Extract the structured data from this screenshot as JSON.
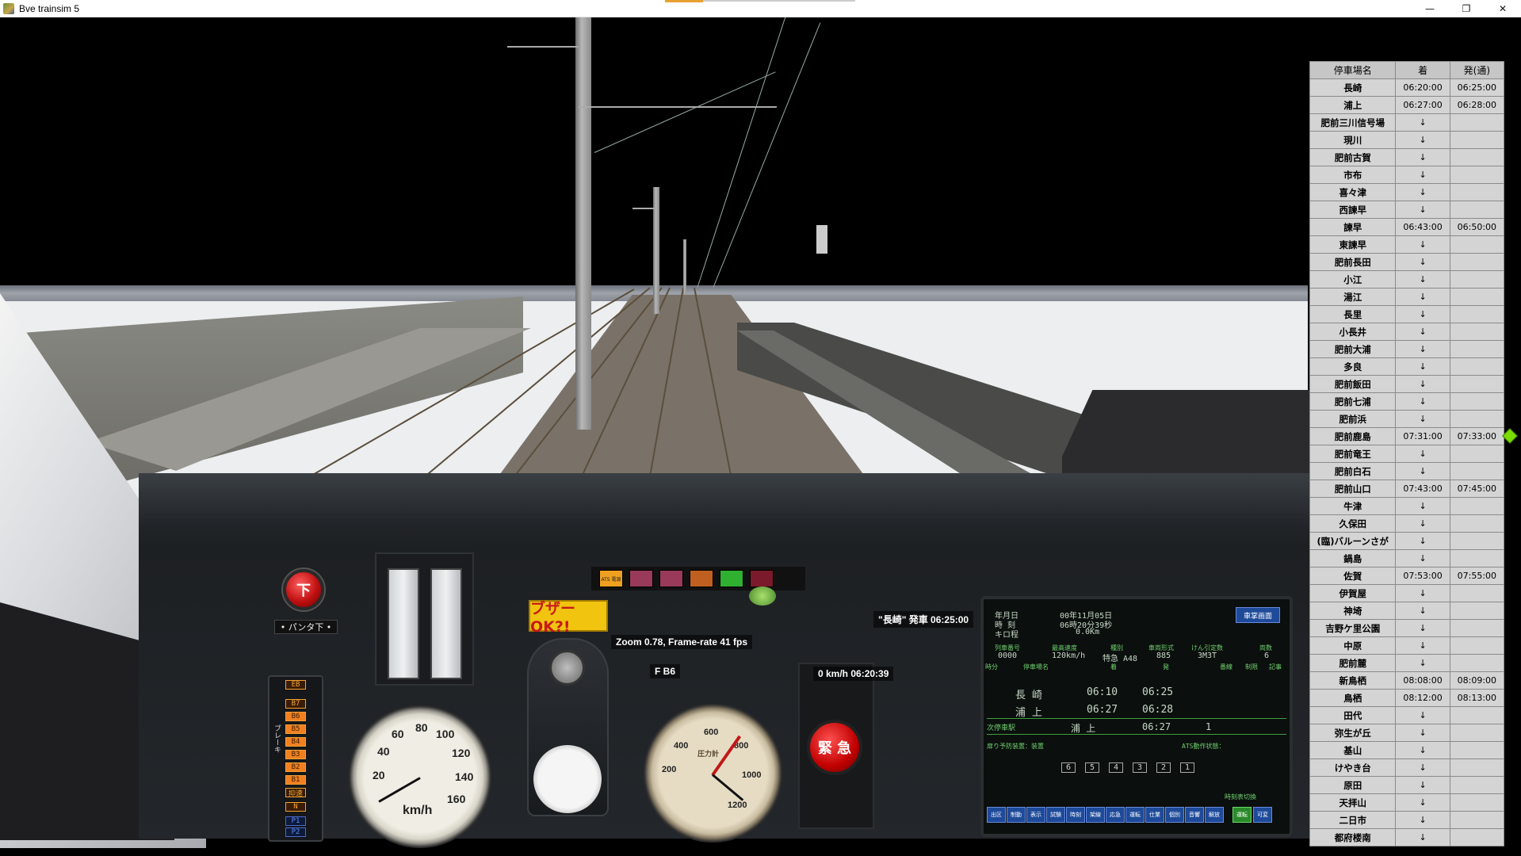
{
  "window": {
    "title": "Bve trainsim 5",
    "controls": {
      "minimize": "—",
      "maximize": "❐",
      "close": "✕"
    }
  },
  "cab": {
    "pantograph_button": "下",
    "pantograph_label": "• パンタ下 •",
    "brake_label": "ブレーキ",
    "brake_notches": [
      "EB",
      "B7",
      "B6",
      "B5",
      "B4",
      "B3",
      "B2",
      "B1",
      "抑速"
    ],
    "neutral_notch": "N",
    "power_notches": [
      "P1",
      "P2",
      "P3"
    ],
    "power_label": "カ行",
    "buzzer_label": "ブザーOK?!",
    "emergency_label": "緊 急",
    "speedometer_unit": "km/h",
    "speedometer_ticks": [
      "20",
      "40",
      "60",
      "80",
      "100",
      "120",
      "140",
      "160"
    ],
    "pressure_ticks": [
      "200",
      "400",
      "600",
      "800",
      "1000",
      "1200"
    ],
    "pressure_label": "圧力計",
    "ats_lamp": "ATS 電源"
  },
  "osd": {
    "departure_notice": "\"長崎\" 発車 06:25:00",
    "zoom_fps": "Zoom 0.78, Frame-rate 41 fps",
    "notch": "F  B6",
    "speed_time": "0 km/h  06:20:39"
  },
  "monitor": {
    "date_label": "年月日",
    "date_value": "00年11月05日",
    "time_label": "時 刻",
    "time_value": "06時20分39秒",
    "km_label": "キロ程",
    "km_value": "0.0Km",
    "screen_button": "車掌画面",
    "header_cols": [
      "列車番号",
      "最高速度",
      "種別",
      "車両形式",
      "けん引定数",
      "両数"
    ],
    "train_no": "0000",
    "max_speed": "120km/h",
    "train_type": "特急 A48",
    "car_type": "885",
    "traction": "3M3T",
    "cars": "6",
    "row_headers": [
      "時分",
      "停車場名",
      "着",
      "発",
      "番線",
      "制限",
      "記事"
    ],
    "row1_station": "長 崎",
    "row1_arr": "06:10",
    "row1_dep": "06:25",
    "row2_station": "浦 上",
    "row2_arr": "06:27",
    "row2_dep": "06:28",
    "next_label": "次停車駅",
    "next_station": "浦 上",
    "next_time": "06:27",
    "next_track": "1",
    "status_left": "扉り予防装置：装置",
    "status_right": "ATS動作状態：",
    "car_numbers": [
      "6",
      "5",
      "4",
      "3",
      "2",
      "1"
    ],
    "bottom_buttons": [
      "出区",
      "制動",
      "表示",
      "試験",
      "時刻",
      "架線",
      "応急",
      "運転",
      "仕業",
      "個別",
      "音響",
      "解放"
    ],
    "time_bar_label": "時刻表切換",
    "time_bar_btn1": "運転",
    "time_bar_btn2": "可変"
  },
  "timetable": {
    "headers": [
      "停車場名",
      "着",
      "発(通)"
    ],
    "rows": [
      [
        "長崎",
        "06:20:00",
        "06:25:00"
      ],
      [
        "浦上",
        "06:27:00",
        "06:28:00"
      ],
      [
        "肥前三川信号場",
        "↓",
        ""
      ],
      [
        "現川",
        "↓",
        ""
      ],
      [
        "肥前古賀",
        "↓",
        ""
      ],
      [
        "市布",
        "↓",
        ""
      ],
      [
        "喜々津",
        "↓",
        ""
      ],
      [
        "西諫早",
        "↓",
        ""
      ],
      [
        "諫早",
        "06:43:00",
        "06:50:00"
      ],
      [
        "東諫早",
        "↓",
        ""
      ],
      [
        "肥前長田",
        "↓",
        ""
      ],
      [
        "小江",
        "↓",
        ""
      ],
      [
        "湯江",
        "↓",
        ""
      ],
      [
        "長里",
        "↓",
        ""
      ],
      [
        "小長井",
        "↓",
        ""
      ],
      [
        "肥前大浦",
        "↓",
        ""
      ],
      [
        "多良",
        "↓",
        ""
      ],
      [
        "肥前飯田",
        "↓",
        ""
      ],
      [
        "肥前七浦",
        "↓",
        ""
      ],
      [
        "肥前浜",
        "↓",
        ""
      ],
      [
        "肥前鹿島",
        "07:31:00",
        "07:33:00"
      ],
      [
        "肥前竜王",
        "↓",
        ""
      ],
      [
        "肥前白石",
        "↓",
        ""
      ],
      [
        "肥前山口",
        "07:43:00",
        "07:45:00"
      ],
      [
        "牛津",
        "↓",
        ""
      ],
      [
        "久保田",
        "↓",
        ""
      ],
      [
        "(臨)バルーンさが",
        "↓",
        ""
      ],
      [
        "鍋島",
        "↓",
        ""
      ],
      [
        "佐賀",
        "07:53:00",
        "07:55:00"
      ],
      [
        "伊賀屋",
        "↓",
        ""
      ],
      [
        "神埼",
        "↓",
        ""
      ],
      [
        "吉野ケ里公園",
        "↓",
        ""
      ],
      [
        "中原",
        "↓",
        ""
      ],
      [
        "肥前麓",
        "↓",
        ""
      ],
      [
        "新鳥栖",
        "08:08:00",
        "08:09:00"
      ],
      [
        "鳥栖",
        "08:12:00",
        "08:13:00"
      ],
      [
        "田代",
        "↓",
        ""
      ],
      [
        "弥生が丘",
        "↓",
        ""
      ],
      [
        "基山",
        "↓",
        ""
      ],
      [
        "けやき台",
        "↓",
        ""
      ],
      [
        "原田",
        "↓",
        ""
      ],
      [
        "天拝山",
        "↓",
        ""
      ],
      [
        "二日市",
        "↓",
        ""
      ],
      [
        "都府楼南",
        "↓",
        ""
      ]
    ]
  }
}
